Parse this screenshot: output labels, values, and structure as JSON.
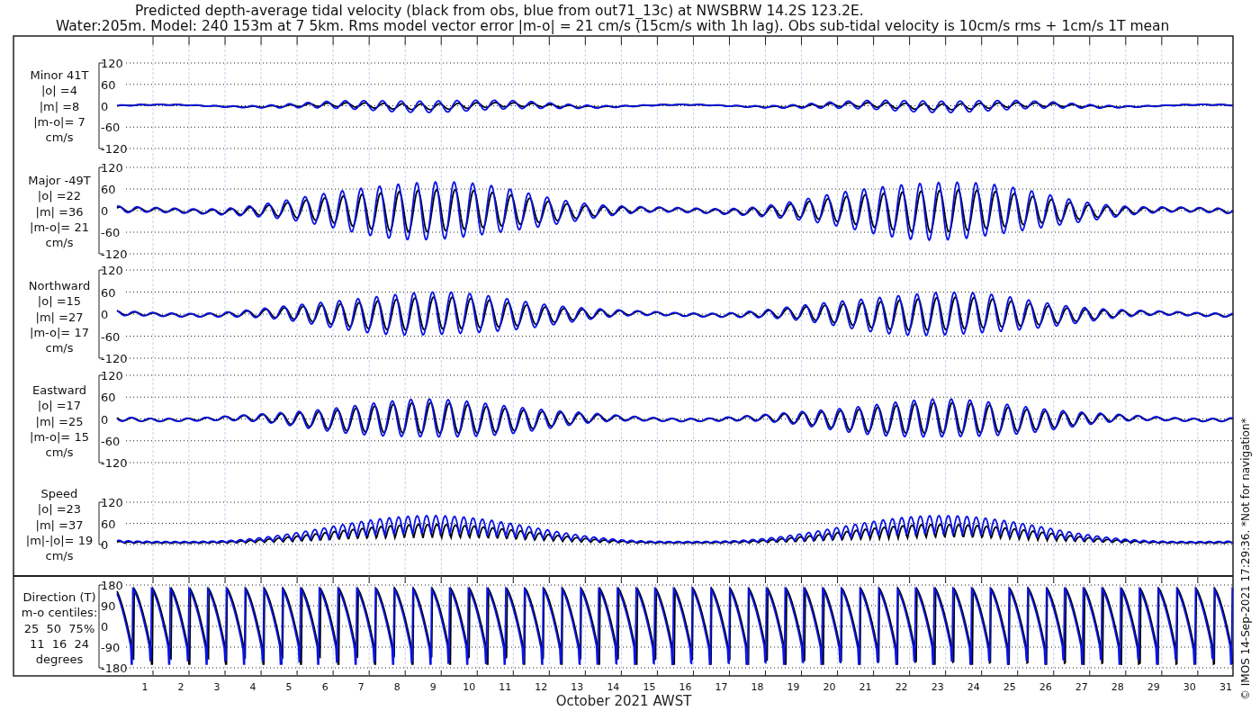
{
  "title_lines": [
    "Predicted depth-average tidal velocity (black from obs, blue from out71_13c) at NWSBRW 14.2S 123.2E.",
    "Water:205m. Model: 240 153m at 7 5km. Rms model vector error |m-o| = 21 cm/s (15cm/s with 1h lag). Obs sub-tidal velocity is 10cm/s rms + 1cm/s 1T mean"
  ],
  "panels": [
    {
      "kind": "velocity",
      "label_lines": [
        "Minor 41T",
        "|o| =4",
        "|m| =8",
        "|m-o|= 7",
        "cm/s"
      ],
      "yticks": [
        "120",
        "60",
        "0",
        "-60",
        "-120"
      ]
    },
    {
      "kind": "velocity",
      "label_lines": [
        "Major -49T",
        "|o| =22",
        "|m| =36",
        "|m-o|= 21",
        "cm/s"
      ],
      "yticks": [
        "120",
        "60",
        "0",
        "-60",
        "-120"
      ]
    },
    {
      "kind": "velocity",
      "label_lines": [
        "Northward",
        "|o| =15",
        "|m| =27",
        "|m-o|= 17",
        "cm/s"
      ],
      "yticks": [
        "120",
        "60",
        "0",
        "-60",
        "-120"
      ]
    },
    {
      "kind": "velocity",
      "label_lines": [
        "Eastward",
        "|o| =17",
        "|m| =25",
        "|m-o|= 15",
        "cm/s"
      ],
      "yticks": [
        "120",
        "60",
        "0",
        "-60",
        "-120"
      ]
    },
    {
      "kind": "speed",
      "label_lines": [
        "Speed",
        "|o| =23",
        "|m| =37",
        "|m|-|o|= 19",
        "cm/s"
      ],
      "yticks": [
        "120",
        "60",
        "0"
      ]
    },
    {
      "kind": "direction",
      "label_lines": [
        "Direction (T)",
        "m-o centiles:",
        "25  50  75%",
        "11  16  24",
        "degrees"
      ],
      "yticks": [
        "180",
        "90",
        "0",
        "-90",
        "-180"
      ]
    }
  ],
  "xticks": [
    "1",
    "2",
    "3",
    "4",
    "5",
    "6",
    "7",
    "8",
    "9",
    "10",
    "11",
    "12",
    "13",
    "14",
    "15",
    "16",
    "17",
    "18",
    "19",
    "20",
    "21",
    "22",
    "23",
    "24",
    "25",
    "26",
    "27",
    "28",
    "29",
    "30",
    "31"
  ],
  "xlabel": "October 2021 AWST",
  "credit": "© IMOS 14-Sep-2021 17:29:36. *Not for navigation*"
}
